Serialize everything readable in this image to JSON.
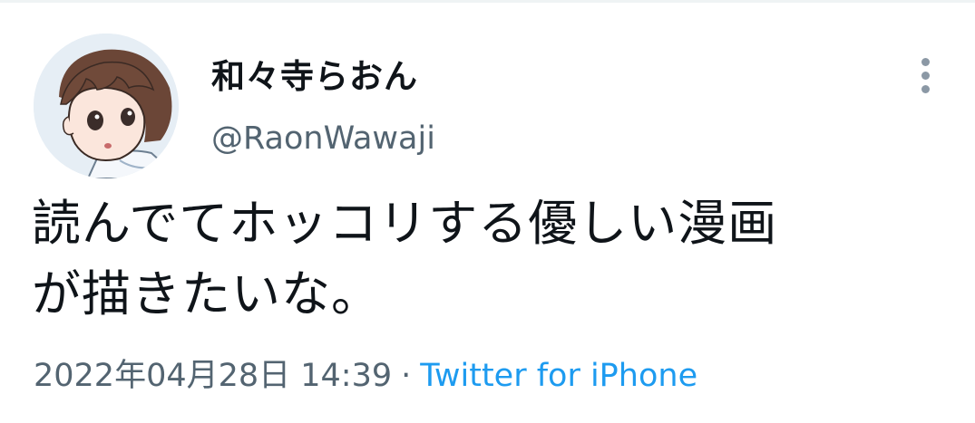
{
  "tweet": {
    "author": {
      "display_name": "和々寺らおん",
      "handle": "@RaonWawaji",
      "avatar_icon": "profile-avatar"
    },
    "text_lines": [
      "読んでてホッコリする優しい漫画",
      "が描きたいな。"
    ],
    "timestamp": "2022年04月28日 14:39",
    "separator": "·",
    "source": "Twitter for iPhone",
    "menu_icon": "more-vertical-icon"
  },
  "colors": {
    "text_primary": "#0f1419",
    "text_secondary": "#536471",
    "link": "#1d9bf0",
    "icon_gray": "#8b98a5"
  }
}
